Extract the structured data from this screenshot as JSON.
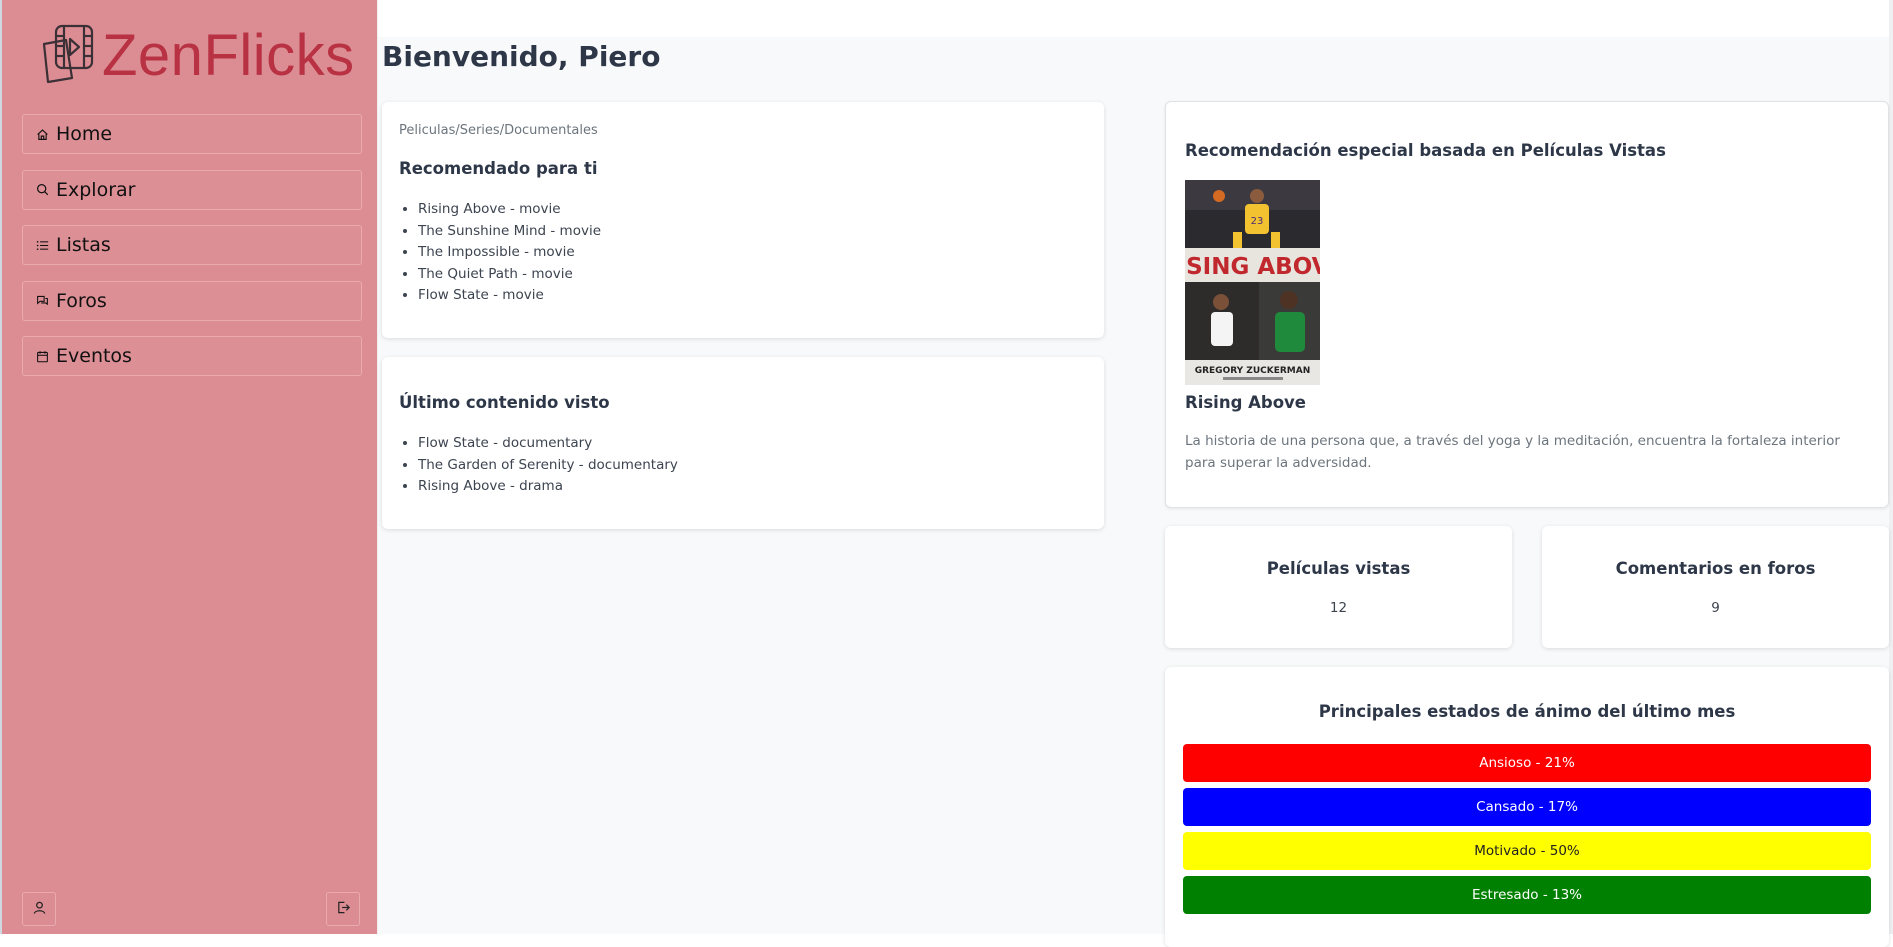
{
  "app": {
    "name": "ZenFlicks"
  },
  "nav": {
    "items": [
      {
        "label": "Home",
        "icon": "home-icon"
      },
      {
        "label": "Explorar",
        "icon": "search-icon"
      },
      {
        "label": "Listas",
        "icon": "list-icon"
      },
      {
        "label": "Foros",
        "icon": "chat-icon"
      },
      {
        "label": "Eventos",
        "icon": "calendar-icon"
      }
    ],
    "bottom": {
      "profile_icon": "user-icon",
      "logout_icon": "logout-icon"
    }
  },
  "header": {
    "title": "Bienvenido, Piero"
  },
  "recommended": {
    "breadcrumb": "Peliculas/Series/Documentales",
    "title": "Recomendado para ti",
    "items": [
      "Rising Above - movie",
      "The Sunshine Mind - movie",
      "The Impossible - movie",
      "The Quiet Path - movie",
      "Flow State - movie"
    ]
  },
  "last_watched": {
    "title": "Último contenido visto",
    "items": [
      "Flow State - documentary",
      "The Garden of Serenity - documentary",
      "Rising Above - drama"
    ]
  },
  "special": {
    "title": "Recomendación especial basada en Películas Vistas",
    "poster": {
      "title_text": "RISING ABOVE",
      "author_text": "GREGORY ZUCKERMAN",
      "jersey_number": "23"
    },
    "movie_title": "Rising Above",
    "description": "La historia de una persona que, a través del yoga y la meditación, encuentra la fortaleza interior para superar la adversidad."
  },
  "stats": [
    {
      "label": "Películas vistas",
      "value": "12"
    },
    {
      "label": "Comentarios en foros",
      "value": "9"
    }
  ],
  "moods": {
    "title": "Principales estados de ánimo del último mes",
    "items": [
      {
        "label": "Ansioso - 21%",
        "percent": 21,
        "color": "#ff0000",
        "text_color": "#ffffff"
      },
      {
        "label": "Cansado - 17%",
        "percent": 17,
        "color": "#0000ff",
        "text_color": "#ffffff"
      },
      {
        "label": "Motivado - 50%",
        "percent": 50,
        "color": "#ffff00",
        "text_color": "#222222"
      },
      {
        "label": "Estresado - 13%",
        "percent": 13,
        "color": "#008000",
        "text_color": "#ffffff"
      }
    ]
  },
  "colors": {
    "sidebar": "#dc8d93",
    "brand": "#b83244",
    "text": "#2d3748"
  }
}
